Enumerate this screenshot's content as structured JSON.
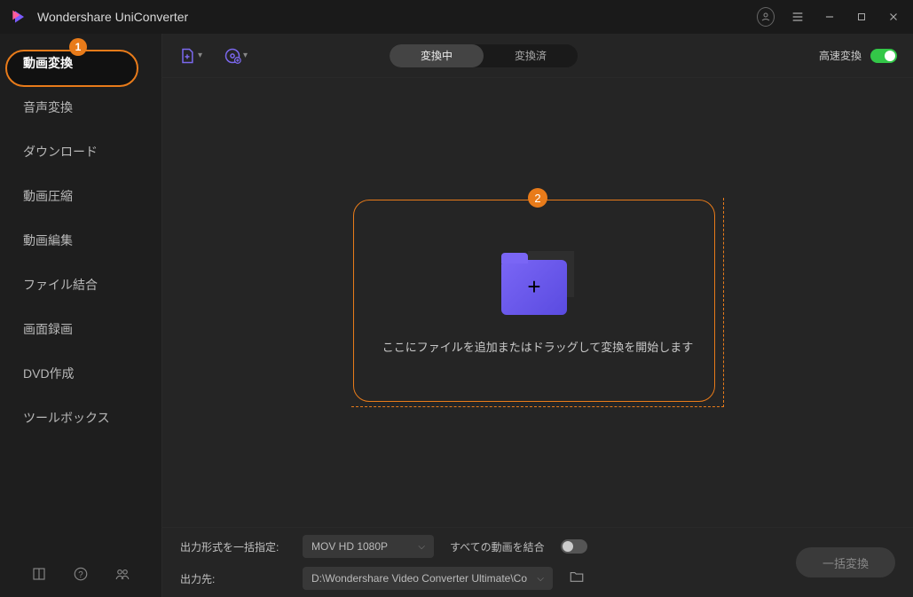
{
  "app": {
    "title": "Wondershare UniConverter"
  },
  "sidebar": {
    "items": [
      {
        "label": "動画変換",
        "badge": "1"
      },
      {
        "label": "音声変換"
      },
      {
        "label": "ダウンロード"
      },
      {
        "label": "動画圧縮"
      },
      {
        "label": "動画編集"
      },
      {
        "label": "ファイル結合"
      },
      {
        "label": "画面録画"
      },
      {
        "label": "DVD作成"
      },
      {
        "label": "ツールボックス"
      }
    ]
  },
  "toolbar": {
    "tabs": {
      "active": "変換中",
      "inactive": "変換済"
    },
    "speed_label": "高速変換"
  },
  "dropzone": {
    "badge": "2",
    "text": "ここにファイルを追加またはドラッグして変換を開始します"
  },
  "footer": {
    "format_label": "出力形式を一括指定:",
    "format_value": "MOV HD 1080P",
    "merge_label": "すべての動画を結合",
    "output_label": "出力先:",
    "output_value": "D:\\Wondershare Video Converter Ultimate\\Co",
    "convert_btn": "一括変換"
  }
}
